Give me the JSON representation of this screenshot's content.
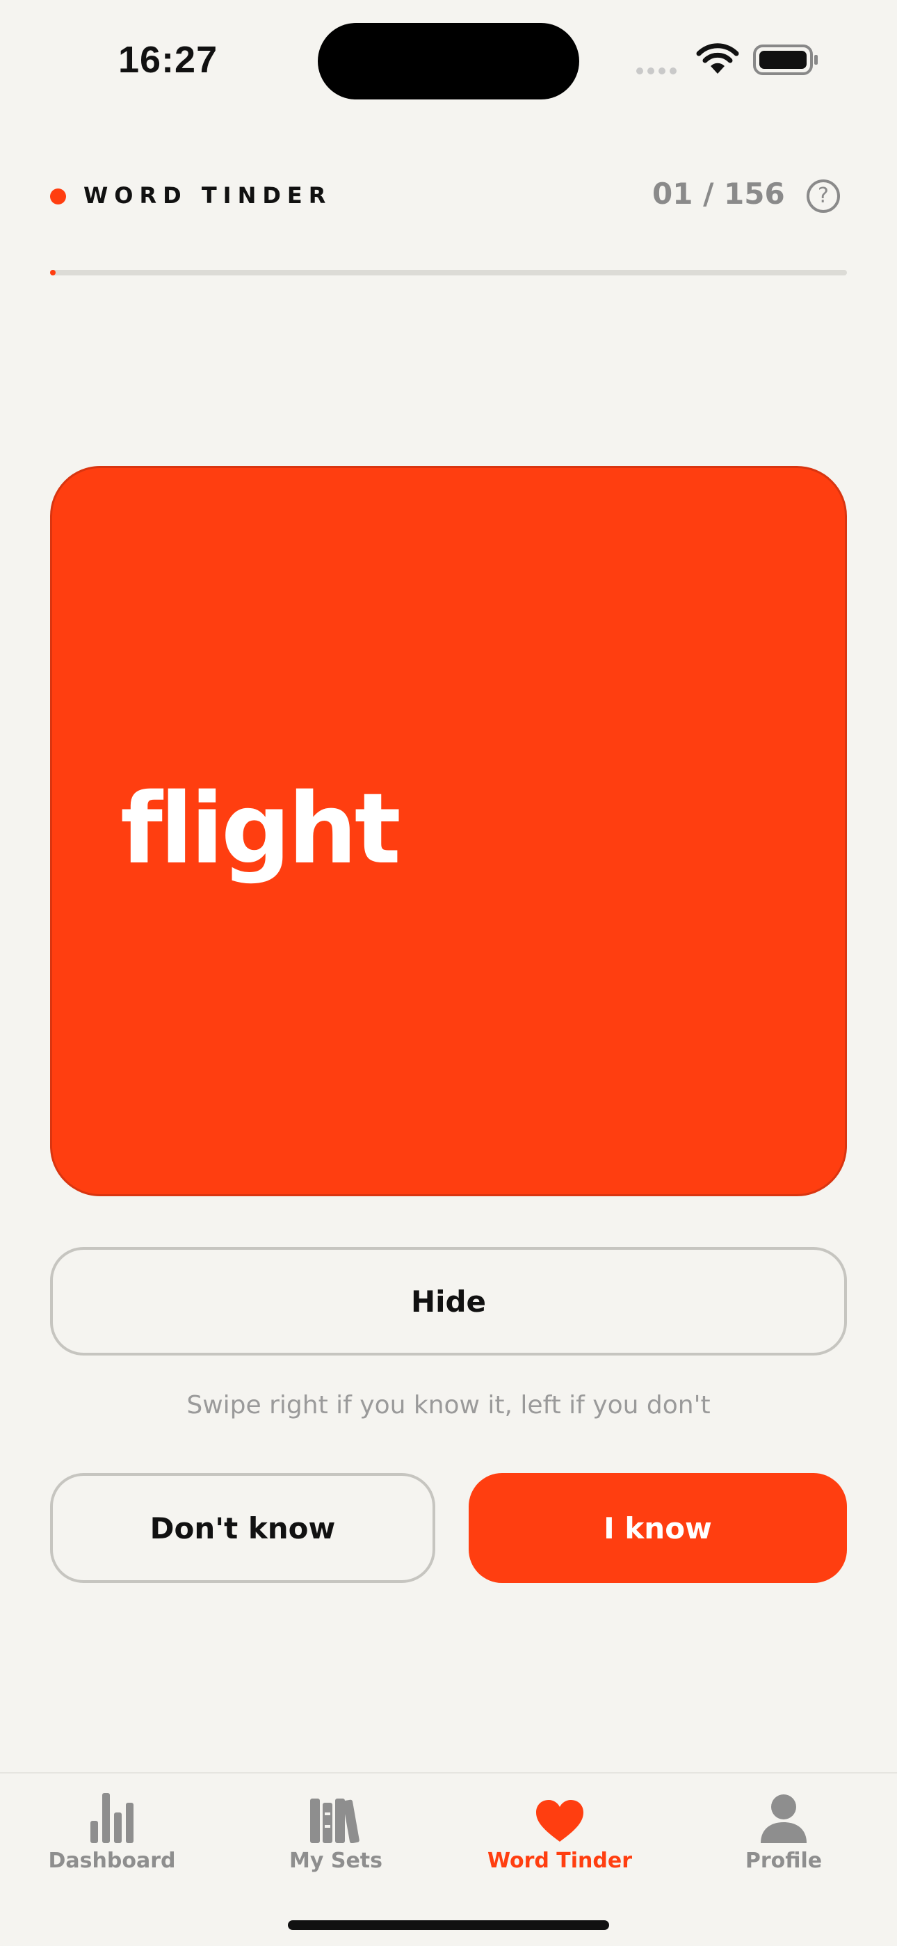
{
  "status_bar": {
    "time": "16:27"
  },
  "header": {
    "title": "WORD TINDER",
    "counter": "01 / 156",
    "help_icon": "question-circle-icon",
    "progress": 0.0064,
    "accent": "#ff3e10"
  },
  "card": {
    "word": "flight",
    "color": "#ff3e10"
  },
  "actions": {
    "hide_label": "Hide",
    "hint": "Swipe right if you know it, left if you don't",
    "dont_know_label": "Don't know",
    "know_label": "I know"
  },
  "tabbar": {
    "items": [
      {
        "label": "Dashboard",
        "icon": "bar-chart-icon",
        "active": false
      },
      {
        "label": "My Sets",
        "icon": "books-icon",
        "active": false
      },
      {
        "label": "Word Tinder",
        "icon": "heart-icon",
        "active": true
      },
      {
        "label": "Profile",
        "icon": "person-icon",
        "active": false
      }
    ]
  }
}
